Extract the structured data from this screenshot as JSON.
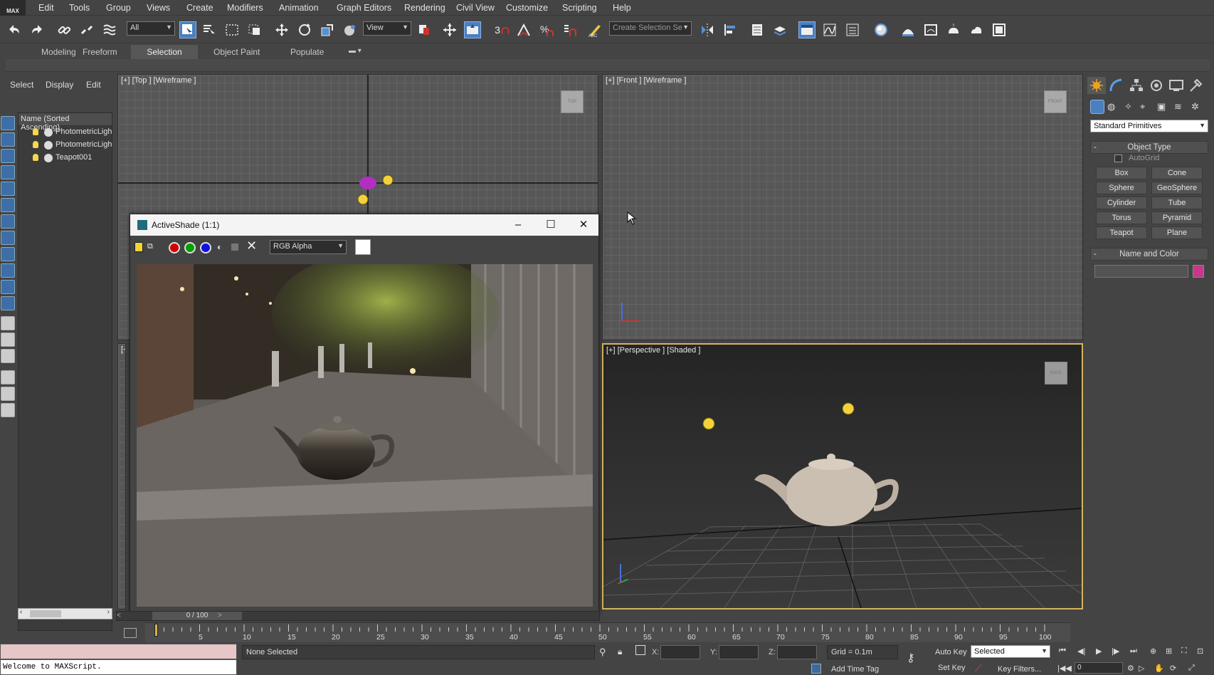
{
  "app": {
    "logo": "MAX"
  },
  "menu": [
    "Edit",
    "Tools",
    "Group",
    "Views",
    "Create",
    "Modifiers",
    "Animation",
    "Graph Editors",
    "Rendering",
    "Civil View",
    "Customize",
    "Scripting",
    "Help"
  ],
  "toolbar": {
    "selection_filter": "All",
    "ref_coord": "View",
    "named_selection_placeholder": "Create Selection Se",
    "snap_label": "3"
  },
  "ribbon": {
    "tabs": [
      {
        "label": "Modeling",
        "selected": false
      },
      {
        "label": "Freeform",
        "selected": false
      },
      {
        "label": "Selection",
        "selected": true
      },
      {
        "label": "Object Paint",
        "selected": false
      },
      {
        "label": "Populate",
        "selected": false
      }
    ]
  },
  "scene_explorer": {
    "tabs": [
      "Select",
      "Display",
      "Edit"
    ],
    "header": "Name (Sorted Ascending)",
    "items": [
      {
        "name": "PhotometricLigh",
        "icon": "light-icon"
      },
      {
        "name": "PhotometricLigh",
        "icon": "light-icon"
      },
      {
        "name": "Teapot001",
        "icon": "teapot-icon"
      }
    ]
  },
  "viewports": {
    "top": {
      "label": "[+] [Top ] [Wireframe ]",
      "cube": "TOP"
    },
    "front": {
      "label": "[+] [Front ] [Wireframe ]",
      "cube": "FRONT"
    },
    "perspective": {
      "label": "[+] [Perspective ] [Shaded ]",
      "cube": "BACK"
    },
    "left_partial": {
      "label": "[+"
    }
  },
  "activeshade": {
    "title": "ActiveShade (1:1)",
    "channel": "RGB Alpha",
    "channel_colors": [
      "#d40000",
      "#00a000",
      "#1010e0"
    ]
  },
  "timeline": {
    "frame_display": "0 / 100",
    "ticks": [
      "5",
      "10",
      "15",
      "20",
      "25",
      "30",
      "35",
      "40",
      "45",
      "50",
      "55",
      "60",
      "65",
      "70",
      "75",
      "80",
      "85",
      "90",
      "95",
      "100"
    ]
  },
  "status": {
    "maxscript_output": "Welcome to MAXScript.",
    "selection_text": "None Selected",
    "x_label": "X:",
    "y_label": "Y:",
    "z_label": "Z:",
    "grid": "Grid = 0.1m",
    "add_time_tag": "Add Time Tag",
    "auto_key": "Auto Key",
    "set_key": "Set Key",
    "key_mode": "Selected",
    "key_filters": "Key Filters...",
    "current_frame": "0"
  },
  "command_panel": {
    "category": "Standard Primitives",
    "object_type_title": "Object Type",
    "autogrid": "AutoGrid",
    "primitives": [
      "Box",
      "Cone",
      "Sphere",
      "GeoSphere",
      "Cylinder",
      "Tube",
      "Torus",
      "Pyramid",
      "Teapot",
      "Plane"
    ],
    "name_color_title": "Name and Color",
    "object_color": "#c23a8a"
  }
}
